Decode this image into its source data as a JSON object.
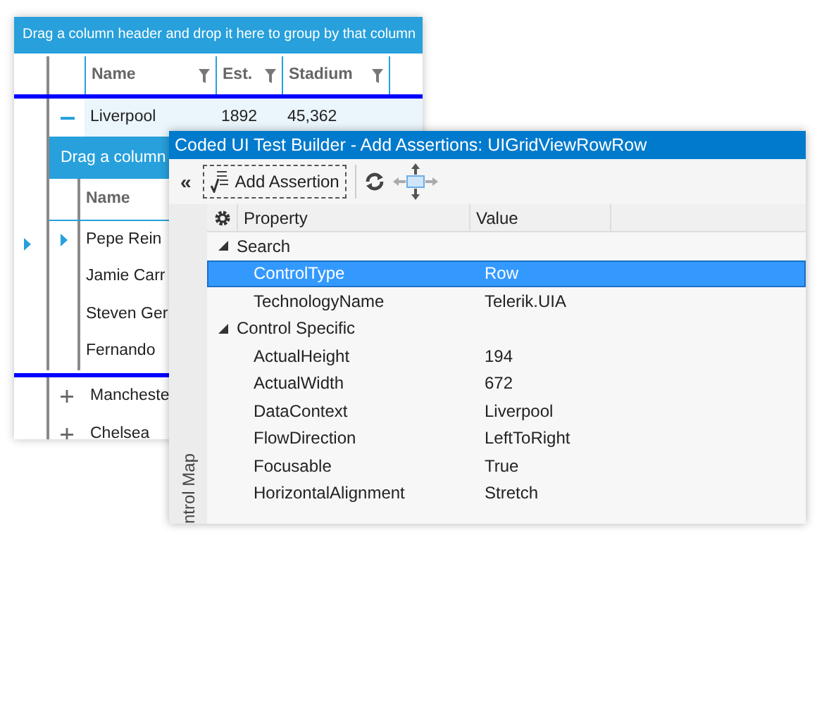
{
  "grid": {
    "group_panel": "Drag a column header and drop it here to group by that column",
    "columns": [
      {
        "label": "Name"
      },
      {
        "label": "Est."
      },
      {
        "label": "Stadium"
      }
    ],
    "rows": [
      {
        "cells": [
          "Liverpool",
          "1892",
          "45,362"
        ],
        "expanded": true,
        "detail": {
          "group_panel": "Drag a column",
          "columns": [
            {
              "label": "Name"
            }
          ],
          "rows": [
            {
              "name": "Pepe Rein",
              "current": true
            },
            {
              "name": "Jamie Carr",
              "current": false
            },
            {
              "name": "Steven Ger",
              "current": false
            },
            {
              "name": "Fernando",
              "current": false
            }
          ]
        }
      },
      {
        "cells": [
          "Mancheste"
        ],
        "expanded": false
      },
      {
        "cells": [
          "Chelsea"
        ],
        "expanded": false
      }
    ]
  },
  "dialog": {
    "title": "Coded UI Test Builder - Add Assertions: UIGridViewRowRow",
    "toolbar": {
      "collapse": "«",
      "add_assertion": "Add Assertion"
    },
    "side_tab": "ntrol Map",
    "property_grid": {
      "columns": [
        "Property",
        "Value"
      ],
      "groups": [
        {
          "label": "Search",
          "expanded": true,
          "rows": [
            {
              "property": "ControlType",
              "value": "Row",
              "selected": true
            },
            {
              "property": "TechnologyName",
              "value": "Telerik.UIA",
              "selected": false
            }
          ]
        },
        {
          "label": "Control Specific",
          "expanded": true,
          "rows": [
            {
              "property": "ActualHeight",
              "value": "194",
              "selected": false
            },
            {
              "property": "ActualWidth",
              "value": "672",
              "selected": false
            },
            {
              "property": "DataContext",
              "value": "Liverpool",
              "selected": false
            },
            {
              "property": "FlowDirection",
              "value": "LeftToRight",
              "selected": false
            },
            {
              "property": "Focusable",
              "value": "True",
              "selected": false
            },
            {
              "property": "HorizontalAlignment",
              "value": "Stretch",
              "selected": false
            }
          ]
        }
      ]
    }
  }
}
